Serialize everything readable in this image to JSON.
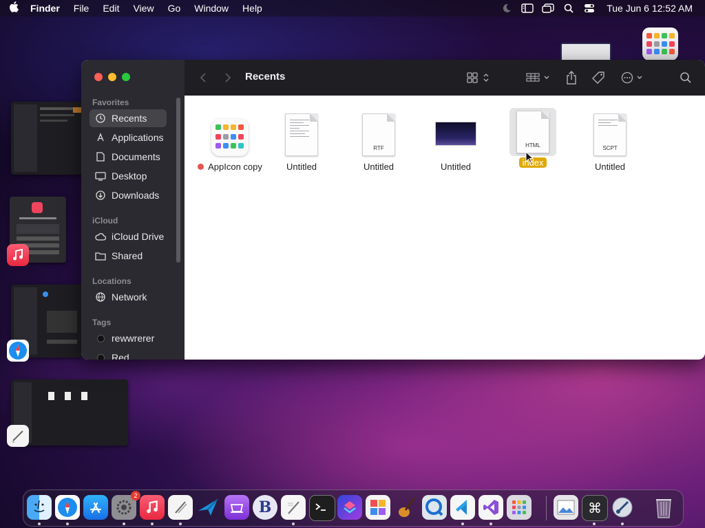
{
  "menubar": {
    "app_name": "Finder",
    "menus": [
      "File",
      "Edit",
      "View",
      "Go",
      "Window",
      "Help"
    ],
    "clock": "Tue Jun 6  12:52 AM",
    "status_icons": [
      "moon-icon",
      "sidebar-icon",
      "screen-mirroring-icon",
      "search-icon",
      "control-center-icon"
    ]
  },
  "finder": {
    "title": "Recents",
    "sidebar": {
      "favorites_label": "Favorites",
      "favorites": [
        "Recents",
        "Applications",
        "Documents",
        "Desktop",
        "Downloads"
      ],
      "icloud_label": "iCloud",
      "icloud": [
        "iCloud Drive",
        "Shared"
      ],
      "locations_label": "Locations",
      "locations": [
        "Network"
      ],
      "tags_label": "Tags",
      "tags": [
        "rewwrerer",
        "Red"
      ]
    },
    "files": [
      {
        "name": "AppIcon copy",
        "kind": "app-icon",
        "tag": "#e5554f"
      },
      {
        "name": "Untitled",
        "kind": "text-document"
      },
      {
        "name": "Untitled",
        "kind": "document",
        "ext": "RTF"
      },
      {
        "name": "Untitled",
        "kind": "image-preview"
      },
      {
        "name": "index",
        "kind": "document",
        "ext": "HTML",
        "selected": true
      },
      {
        "name": "Untitled",
        "kind": "document",
        "ext": "SCPT"
      }
    ]
  },
  "dock": {
    "apps": [
      "Finder",
      "Safari",
      "App Store",
      "System Settings",
      "Music",
      "Script Editor",
      "Migrate",
      "Podcast Studio",
      "BBEdit",
      "TextEdit",
      "Terminal",
      "Shortcuts",
      "Photo Booth",
      "GarageBand",
      "QuickTime",
      "Visual Studio Code",
      "Visual Studio",
      "Launchpad",
      "Preview",
      "Keyboard Viewer",
      "Instruments",
      "Trash"
    ],
    "settings_badge": "2"
  },
  "colors": {
    "accent_selection": "#e0a800",
    "red_tag": "#e5554f"
  }
}
